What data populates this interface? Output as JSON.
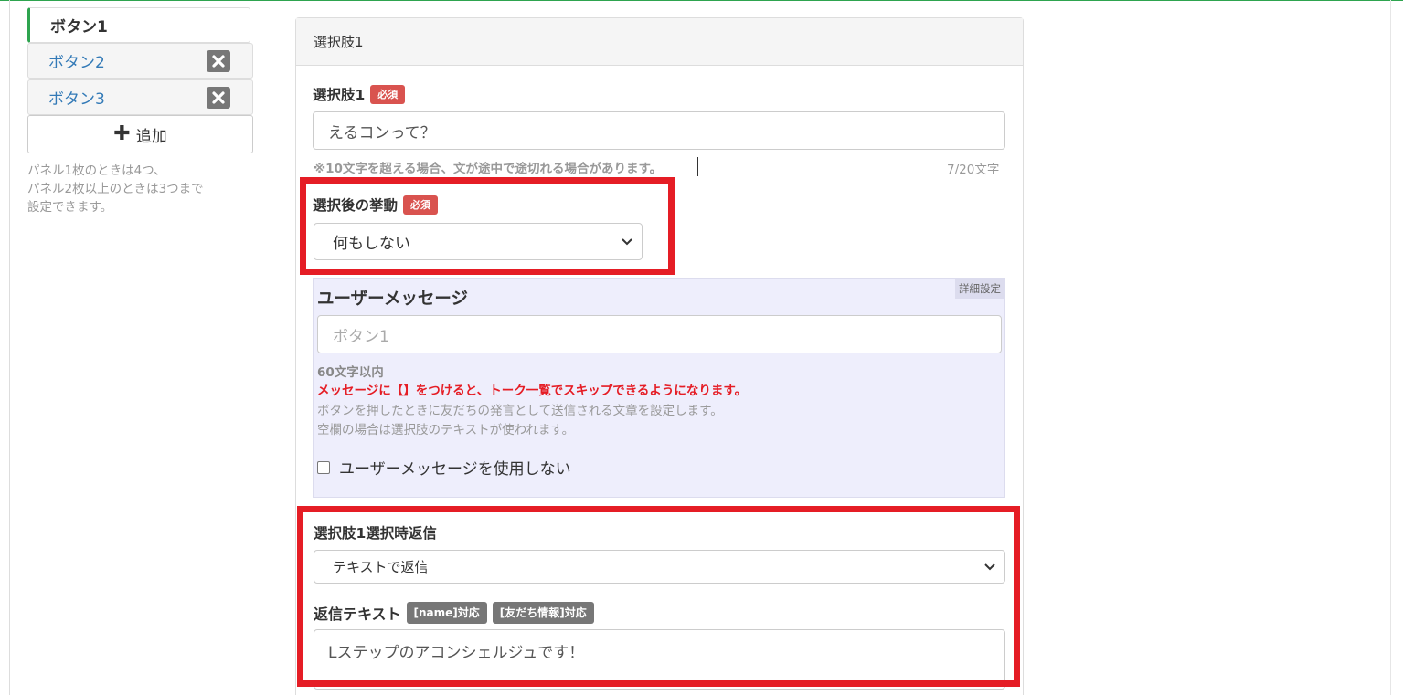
{
  "sidebar": {
    "tabs": [
      {
        "label": "ボタン1"
      },
      {
        "label": "ボタン2"
      },
      {
        "label": "ボタン3"
      }
    ],
    "add_label": "追加",
    "note_lines": [
      "パネル1枚のときは4つ、",
      "パネル2枚以上のときは3つまで",
      "設定できます。"
    ]
  },
  "panel": {
    "title": "選択肢1",
    "choice": {
      "label": "選択肢1",
      "required": "必須",
      "value": "えるコンって？",
      "hint": "※10文字を超える場合、文が途中で途切れる場合があります。",
      "counter": "7/20文字"
    },
    "behavior": {
      "label": "選択後の挙動",
      "required": "必須",
      "selected": "何もしない"
    },
    "user_message": {
      "tag": "詳細設定",
      "title": "ユーザーメッセージ",
      "placeholder": "ボタン1",
      "limit": "60文字以内",
      "warning": "メッセージに【】をつけると、トーク一覧でスキップできるようになります。",
      "desc1": "ボタンを押したときに友だちの発言として送信される文章を設定します。",
      "desc2": "空欄の場合は選択肢のテキストが使われます。",
      "checkbox_label": "ユーザーメッセージを使用しない"
    },
    "reply": {
      "label": "選択肢1選択時返信",
      "selected": "テキストで返信",
      "text_label": "返信テキスト",
      "badge_name": "[name]対応",
      "badge_friend": "[友だち情報]対応",
      "text_value": "Lステップのアコンシェルジュです！"
    }
  },
  "colors": {
    "accent": "#2ea44f",
    "required": "#d9534f",
    "highlight": "#e51d25",
    "link": "#337ab7"
  }
}
